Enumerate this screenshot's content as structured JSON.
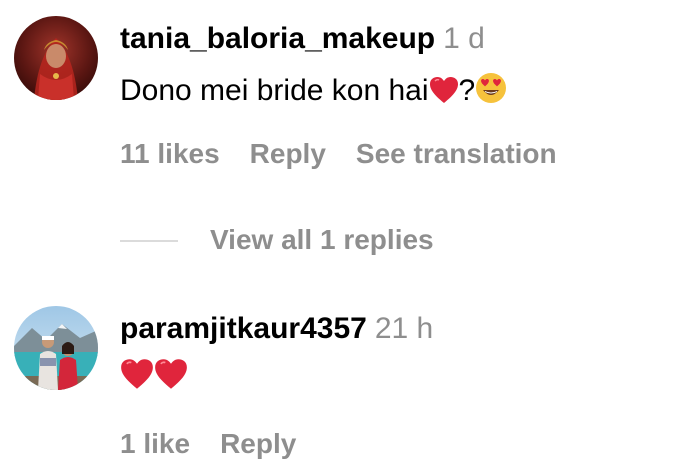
{
  "comments": [
    {
      "username": "tania_baloria_makeup",
      "time": "1 d",
      "text_before": "Dono mei bride kon hai",
      "text_mid": "?",
      "emoji_after_text": [
        "red-heart-icon",
        "heart-eyes-face-icon"
      ],
      "likes_label": "11 likes",
      "reply_label": "Reply",
      "translate_label": "See translation",
      "view_replies_label": "View all 1 replies"
    },
    {
      "username": "paramjitkaur4357",
      "time": "21 h",
      "emoji": [
        "red-heart-icon",
        "red-heart-icon"
      ],
      "likes_label": "1 like",
      "reply_label": "Reply"
    }
  ],
  "colors": {
    "text_primary": "#000000",
    "text_secondary": "#8e8e8e",
    "divider": "#dbdbdb",
    "heart_red": "#e0253c",
    "emoji_yellow": "#f6c23c"
  }
}
